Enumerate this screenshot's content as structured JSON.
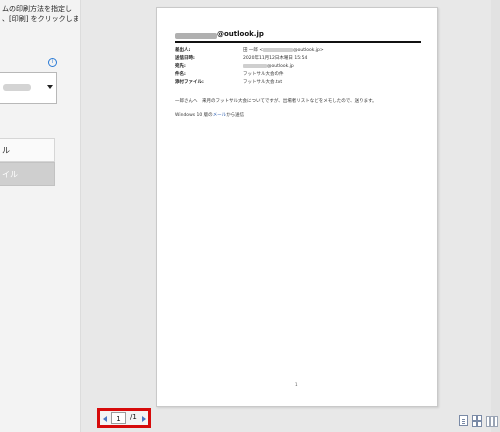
{
  "instructions": {
    "line1": "ムの印刷方法を指定し",
    "line2": "、[印刷] をクリックしま"
  },
  "info_icon_glyph": "i",
  "options": {
    "item1": "ル",
    "item2": "イル"
  },
  "email": {
    "header_address": "@outlook.jp",
    "fields": [
      {
        "label": "差出人:",
        "value_pre": "田 一郎 <",
        "value_post": "@outlook.jp>"
      },
      {
        "label": "送信日時:",
        "value_pre": "2020年11月12日木曜日 15:54",
        "value_post": ""
      },
      {
        "label": "宛先:",
        "value_pre": "",
        "value_post": "@outlook.jp"
      },
      {
        "label": "件名:",
        "value_pre": "フットサル大会の件",
        "value_post": ""
      },
      {
        "label": "添付ファイル:",
        "value_pre": "フットサル大会.txt",
        "value_post": ""
      }
    ],
    "body_line1": "一郎さんへ　来月のフットサル大会についてですが、出場者リストなどをメモしたので、送ります。",
    "body_line2_pre": "Windows 10 版の",
    "body_line2_link": "メール",
    "body_line2_post": "から送信",
    "page_number": "1"
  },
  "navigator": {
    "current_page": "1",
    "total_pages": "/1"
  },
  "colors": {
    "highlight_box": "#d60b0b",
    "nav_arrows": "#4a77c4",
    "link": "#2a5db0"
  },
  "icons": [
    "arrow-left-icon",
    "arrow-right-icon",
    "fit-page-icon",
    "grid-pages-icon",
    "columns-icon",
    "info-icon"
  ]
}
